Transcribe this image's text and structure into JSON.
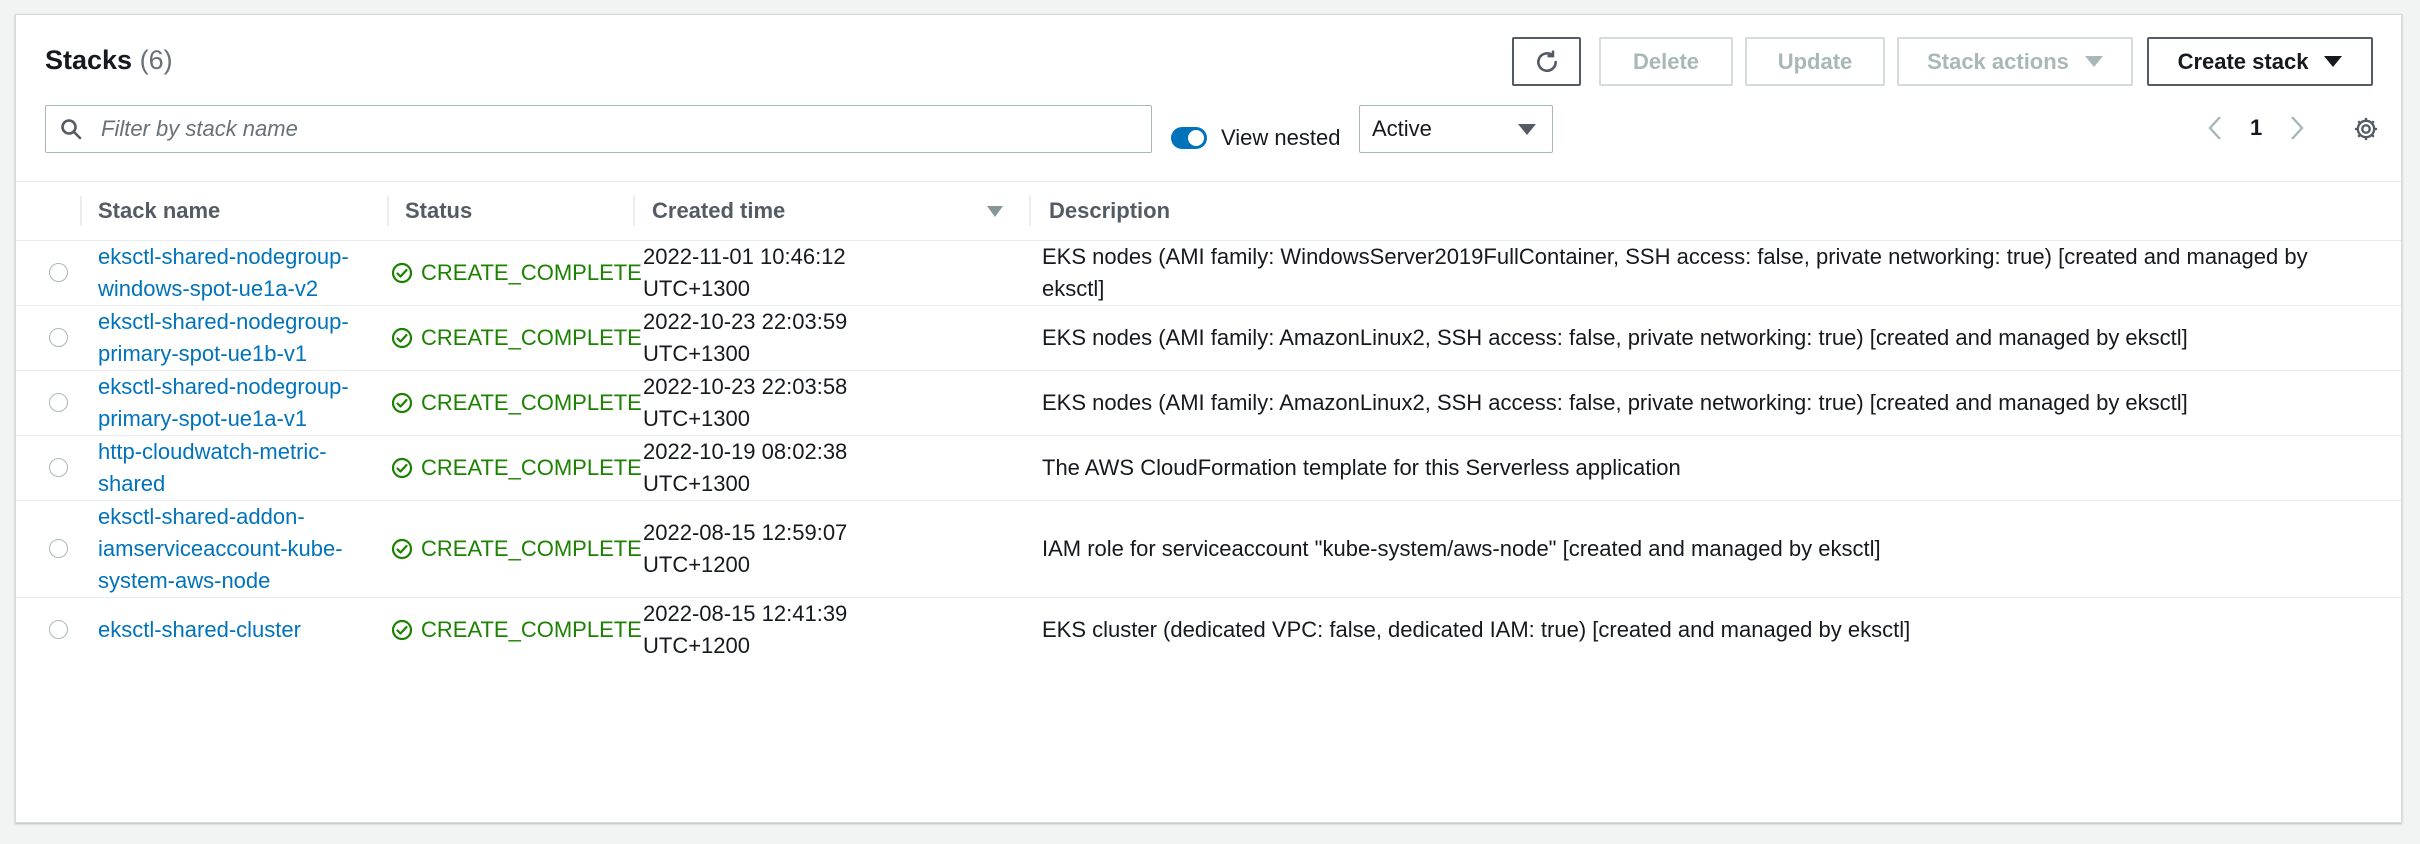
{
  "header": {
    "title": "Stacks",
    "count": "(6)",
    "buttons": {
      "refresh_icon": "refresh-icon",
      "delete": "Delete",
      "update": "Update",
      "stack_actions": "Stack actions",
      "create_stack": "Create stack"
    },
    "search": {
      "placeholder": "Filter by stack name",
      "value": ""
    },
    "view_nested": {
      "label": "View nested",
      "checked": true
    },
    "status_filter": {
      "selected": "Active"
    },
    "pagination": {
      "page": "1"
    }
  },
  "table": {
    "columns": [
      "Stack name",
      "Status",
      "Created time",
      "Description"
    ],
    "sort_column": "Created time",
    "sort_direction": "descending",
    "rows": [
      {
        "name": "eksctl-shared-nodegroup-windows-spot-ue1a-v2",
        "status": "CREATE_COMPLETE",
        "created_date": "2022-11-01 10:46:12",
        "created_tz": "UTC+1300",
        "description": "EKS nodes (AMI family: WindowsServer2019FullContainer, SSH access: false, private networking: true) [created and managed by eksctl]"
      },
      {
        "name": "eksctl-shared-nodegroup-primary-spot-ue1b-v1",
        "status": "CREATE_COMPLETE",
        "created_date": "2022-10-23 22:03:59",
        "created_tz": "UTC+1300",
        "description": "EKS nodes (AMI family: AmazonLinux2, SSH access: false, private networking: true) [created and managed by eksctl]"
      },
      {
        "name": "eksctl-shared-nodegroup-primary-spot-ue1a-v1",
        "status": "CREATE_COMPLETE",
        "created_date": "2022-10-23 22:03:58",
        "created_tz": "UTC+1300",
        "description": "EKS nodes (AMI family: AmazonLinux2, SSH access: false, private networking: true) [created and managed by eksctl]"
      },
      {
        "name": "http-cloudwatch-metric-shared",
        "status": "CREATE_COMPLETE",
        "created_date": "2022-10-19 08:02:38",
        "created_tz": "UTC+1300",
        "description": "The AWS CloudFormation template for this Serverless application"
      },
      {
        "name": "eksctl-shared-addon-iamserviceaccount-kube-system-aws-node",
        "status": "CREATE_COMPLETE",
        "created_date": "2022-08-15 12:59:07",
        "created_tz": "UTC+1200",
        "description": "IAM role for serviceaccount \"kube-system/aws-node\" [created and managed by eksctl]"
      },
      {
        "name": "eksctl-shared-cluster",
        "status": "CREATE_COMPLETE",
        "created_date": "2022-08-15 12:41:39",
        "created_tz": "UTC+1200",
        "description": "EKS cluster (dedicated VPC: false, dedicated IAM: true) [created and managed by eksctl]"
      }
    ]
  },
  "colors": {
    "link": "#0073bb",
    "success": "#1d8102",
    "toggle_on": "#0073bb"
  }
}
